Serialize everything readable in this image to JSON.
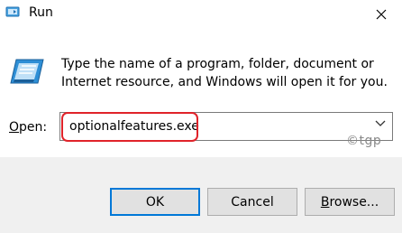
{
  "window": {
    "title": "Run",
    "app_icon": "run-app-icon",
    "close_icon": "close-icon"
  },
  "description": "Type the name of a program, folder, document or Internet resource, and Windows will open it for you.",
  "open_field": {
    "label_accel": "O",
    "label_rest": "pen:",
    "value": "optionalfeatures.exe",
    "dropdown_icon": "chevron-down-icon"
  },
  "watermark": "©tgp",
  "buttons": {
    "ok": "OK",
    "cancel": "Cancel",
    "browse_accel": "B",
    "browse_rest": "rowse..."
  },
  "colors": {
    "highlight": "#e0232a",
    "primary_border": "#0078d7",
    "footer_bg": "#f0f0f0"
  }
}
